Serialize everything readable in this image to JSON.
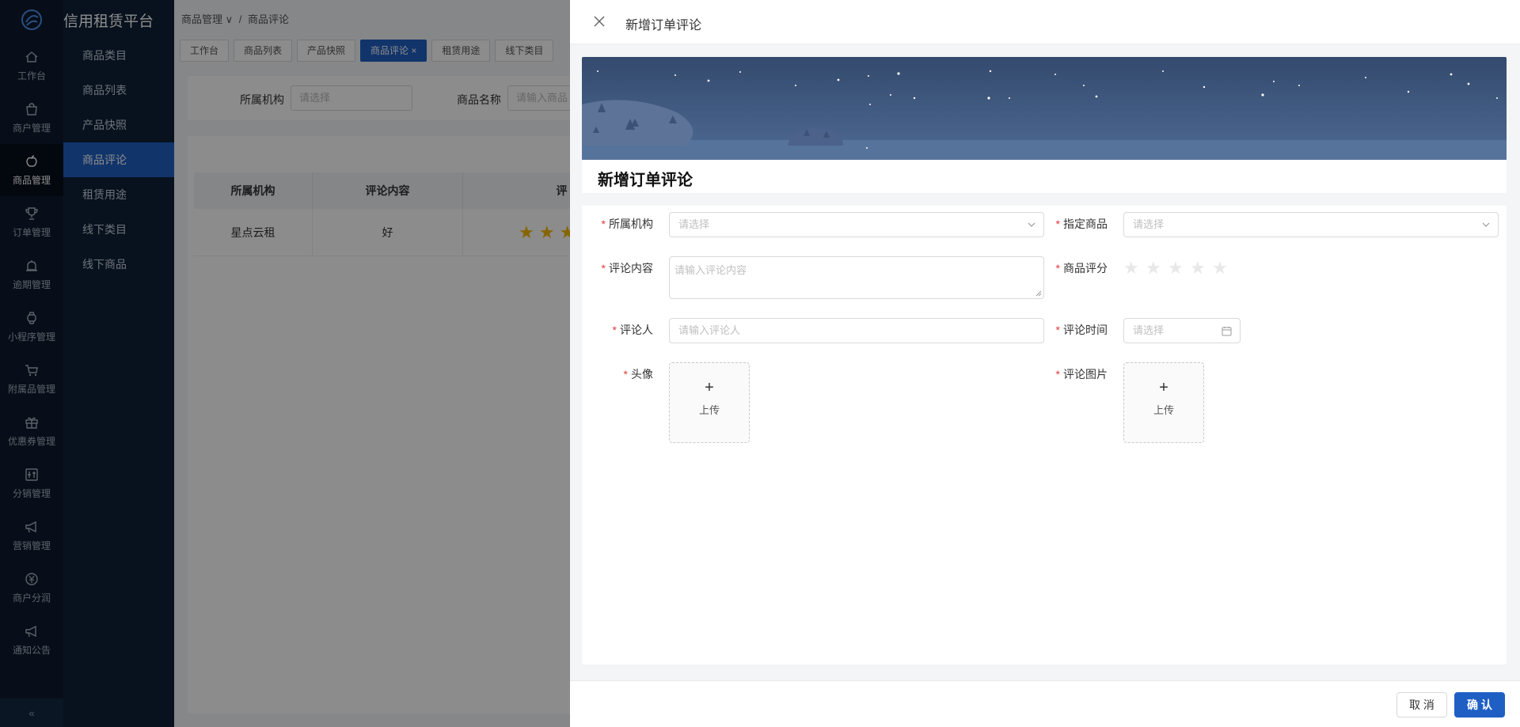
{
  "app": {
    "title": "信用租赁平台"
  },
  "rail": {
    "items": [
      {
        "label": "工作台",
        "icon": "home-icon"
      },
      {
        "label": "商户管理",
        "icon": "shop-icon"
      },
      {
        "label": "商品管理",
        "icon": "apple-icon",
        "active": true
      },
      {
        "label": "订单管理",
        "icon": "trophy-icon"
      },
      {
        "label": "逾期管理",
        "icon": "alarm-icon"
      },
      {
        "label": "小程序管理",
        "icon": "watch-icon"
      },
      {
        "label": "附属品管理",
        "icon": "cart-icon"
      },
      {
        "label": "优惠券管理",
        "icon": "gift-icon"
      },
      {
        "label": "分销管理",
        "icon": "distribution-icon"
      },
      {
        "label": "营销管理",
        "icon": "megaphone-icon"
      },
      {
        "label": "商户分润",
        "icon": "yen-icon"
      },
      {
        "label": "通知公告",
        "icon": "notice-icon"
      }
    ]
  },
  "submenu": {
    "items": [
      "商品类目",
      "商品列表",
      "产品快照",
      "商品评论",
      "租赁用途",
      "线下类目",
      "线下商品"
    ],
    "active_index": 3
  },
  "breadcrumb": {
    "parent": "商品管理",
    "separator": "/",
    "current": "商品评论"
  },
  "tabs": [
    "工作台",
    "商品列表",
    "产品快照",
    "商品评论",
    "租赁用途",
    "线下类目"
  ],
  "filter": {
    "org_label": "所属机构",
    "org_placeholder": "请选择",
    "name_label": "商品名称",
    "name_placeholder": "请输入商品"
  },
  "table": {
    "headers": [
      "所属机构",
      "评论内容",
      "评"
    ],
    "rows": [
      {
        "org": "星点云租",
        "content": "好",
        "stars": 3
      }
    ]
  },
  "drawer": {
    "title": "新增订单评论",
    "card_title": "新增订单评论",
    "form": {
      "org": {
        "label": "所属机构",
        "placeholder": "请选择"
      },
      "product": {
        "label": "指定商品",
        "placeholder": "请选择"
      },
      "content": {
        "label": "评论内容",
        "placeholder": "请输入评论内容"
      },
      "rating": {
        "label": "商品评分",
        "value": 0,
        "max": 5
      },
      "reviewer": {
        "label": "评论人",
        "placeholder": "请输入评论人"
      },
      "time": {
        "label": "评论时间",
        "placeholder": "请选择"
      },
      "avatar": {
        "label": "头像",
        "upload_text": "上传"
      },
      "images": {
        "label": "评论图片",
        "upload_text": "上传"
      }
    },
    "cancel_label": "取 消",
    "ok_label": "确 认"
  },
  "colors": {
    "primary": "#1f5fc4",
    "sidebar": "#0d1b2e",
    "required": "#e4393c"
  }
}
